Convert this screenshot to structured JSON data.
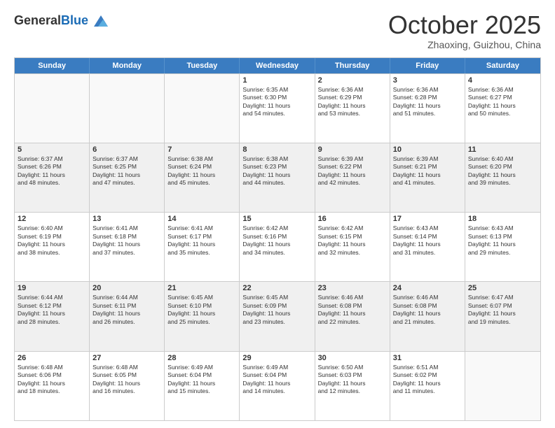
{
  "header": {
    "logo_line1": "General",
    "logo_line2": "Blue",
    "month": "October 2025",
    "location": "Zhaoxing, Guizhou, China"
  },
  "weekdays": [
    "Sunday",
    "Monday",
    "Tuesday",
    "Wednesday",
    "Thursday",
    "Friday",
    "Saturday"
  ],
  "weeks": [
    [
      {
        "day": "",
        "info": ""
      },
      {
        "day": "",
        "info": ""
      },
      {
        "day": "",
        "info": ""
      },
      {
        "day": "1",
        "info": "Sunrise: 6:35 AM\nSunset: 6:30 PM\nDaylight: 11 hours\nand 54 minutes."
      },
      {
        "day": "2",
        "info": "Sunrise: 6:36 AM\nSunset: 6:29 PM\nDaylight: 11 hours\nand 53 minutes."
      },
      {
        "day": "3",
        "info": "Sunrise: 6:36 AM\nSunset: 6:28 PM\nDaylight: 11 hours\nand 51 minutes."
      },
      {
        "day": "4",
        "info": "Sunrise: 6:36 AM\nSunset: 6:27 PM\nDaylight: 11 hours\nand 50 minutes."
      }
    ],
    [
      {
        "day": "5",
        "info": "Sunrise: 6:37 AM\nSunset: 6:26 PM\nDaylight: 11 hours\nand 48 minutes."
      },
      {
        "day": "6",
        "info": "Sunrise: 6:37 AM\nSunset: 6:25 PM\nDaylight: 11 hours\nand 47 minutes."
      },
      {
        "day": "7",
        "info": "Sunrise: 6:38 AM\nSunset: 6:24 PM\nDaylight: 11 hours\nand 45 minutes."
      },
      {
        "day": "8",
        "info": "Sunrise: 6:38 AM\nSunset: 6:23 PM\nDaylight: 11 hours\nand 44 minutes."
      },
      {
        "day": "9",
        "info": "Sunrise: 6:39 AM\nSunset: 6:22 PM\nDaylight: 11 hours\nand 42 minutes."
      },
      {
        "day": "10",
        "info": "Sunrise: 6:39 AM\nSunset: 6:21 PM\nDaylight: 11 hours\nand 41 minutes."
      },
      {
        "day": "11",
        "info": "Sunrise: 6:40 AM\nSunset: 6:20 PM\nDaylight: 11 hours\nand 39 minutes."
      }
    ],
    [
      {
        "day": "12",
        "info": "Sunrise: 6:40 AM\nSunset: 6:19 PM\nDaylight: 11 hours\nand 38 minutes."
      },
      {
        "day": "13",
        "info": "Sunrise: 6:41 AM\nSunset: 6:18 PM\nDaylight: 11 hours\nand 37 minutes."
      },
      {
        "day": "14",
        "info": "Sunrise: 6:41 AM\nSunset: 6:17 PM\nDaylight: 11 hours\nand 35 minutes."
      },
      {
        "day": "15",
        "info": "Sunrise: 6:42 AM\nSunset: 6:16 PM\nDaylight: 11 hours\nand 34 minutes."
      },
      {
        "day": "16",
        "info": "Sunrise: 6:42 AM\nSunset: 6:15 PM\nDaylight: 11 hours\nand 32 minutes."
      },
      {
        "day": "17",
        "info": "Sunrise: 6:43 AM\nSunset: 6:14 PM\nDaylight: 11 hours\nand 31 minutes."
      },
      {
        "day": "18",
        "info": "Sunrise: 6:43 AM\nSunset: 6:13 PM\nDaylight: 11 hours\nand 29 minutes."
      }
    ],
    [
      {
        "day": "19",
        "info": "Sunrise: 6:44 AM\nSunset: 6:12 PM\nDaylight: 11 hours\nand 28 minutes."
      },
      {
        "day": "20",
        "info": "Sunrise: 6:44 AM\nSunset: 6:11 PM\nDaylight: 11 hours\nand 26 minutes."
      },
      {
        "day": "21",
        "info": "Sunrise: 6:45 AM\nSunset: 6:10 PM\nDaylight: 11 hours\nand 25 minutes."
      },
      {
        "day": "22",
        "info": "Sunrise: 6:45 AM\nSunset: 6:09 PM\nDaylight: 11 hours\nand 23 minutes."
      },
      {
        "day": "23",
        "info": "Sunrise: 6:46 AM\nSunset: 6:08 PM\nDaylight: 11 hours\nand 22 minutes."
      },
      {
        "day": "24",
        "info": "Sunrise: 6:46 AM\nSunset: 6:08 PM\nDaylight: 11 hours\nand 21 minutes."
      },
      {
        "day": "25",
        "info": "Sunrise: 6:47 AM\nSunset: 6:07 PM\nDaylight: 11 hours\nand 19 minutes."
      }
    ],
    [
      {
        "day": "26",
        "info": "Sunrise: 6:48 AM\nSunset: 6:06 PM\nDaylight: 11 hours\nand 18 minutes."
      },
      {
        "day": "27",
        "info": "Sunrise: 6:48 AM\nSunset: 6:05 PM\nDaylight: 11 hours\nand 16 minutes."
      },
      {
        "day": "28",
        "info": "Sunrise: 6:49 AM\nSunset: 6:04 PM\nDaylight: 11 hours\nand 15 minutes."
      },
      {
        "day": "29",
        "info": "Sunrise: 6:49 AM\nSunset: 6:04 PM\nDaylight: 11 hours\nand 14 minutes."
      },
      {
        "day": "30",
        "info": "Sunrise: 6:50 AM\nSunset: 6:03 PM\nDaylight: 11 hours\nand 12 minutes."
      },
      {
        "day": "31",
        "info": "Sunrise: 6:51 AM\nSunset: 6:02 PM\nDaylight: 11 hours\nand 11 minutes."
      },
      {
        "day": "",
        "info": ""
      }
    ]
  ]
}
